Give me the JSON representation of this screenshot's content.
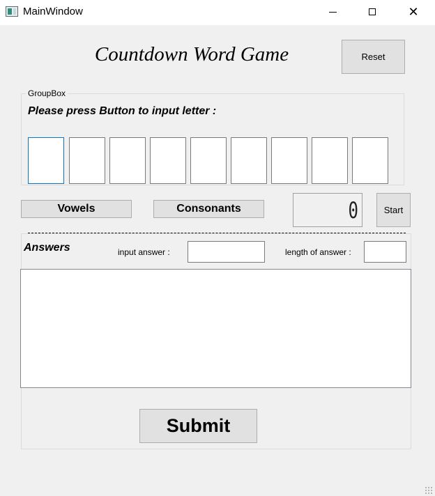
{
  "window": {
    "title": "MainWindow",
    "icon": "app-window-icon",
    "controls": [
      "minimize-icon",
      "maximize-icon",
      "close-icon"
    ],
    "close_glyph": "✕"
  },
  "header": {
    "title": "Countdown Word Game",
    "reset_label": "Reset"
  },
  "letters": {
    "group_label": "GroupBox",
    "instruction": "Please press Button to input letter :",
    "slots": [
      "",
      "",
      "",
      "",
      "",
      "",
      "",
      "",
      ""
    ],
    "focused_slot": 0
  },
  "controls": {
    "vowels_label": "Vowels",
    "consonants_label": "Consonants",
    "timer_value": "0",
    "start_label": "Start"
  },
  "answers": {
    "title": "Answers",
    "input_label": "input answer :",
    "input_value": "",
    "length_label": "length of answer :",
    "length_value": "",
    "list_items": []
  },
  "submit_label": "Submit",
  "colors": {
    "window_bg": "#f0f0f0",
    "button_bg": "#e1e1e1",
    "focus_border": "#0a74c6"
  }
}
